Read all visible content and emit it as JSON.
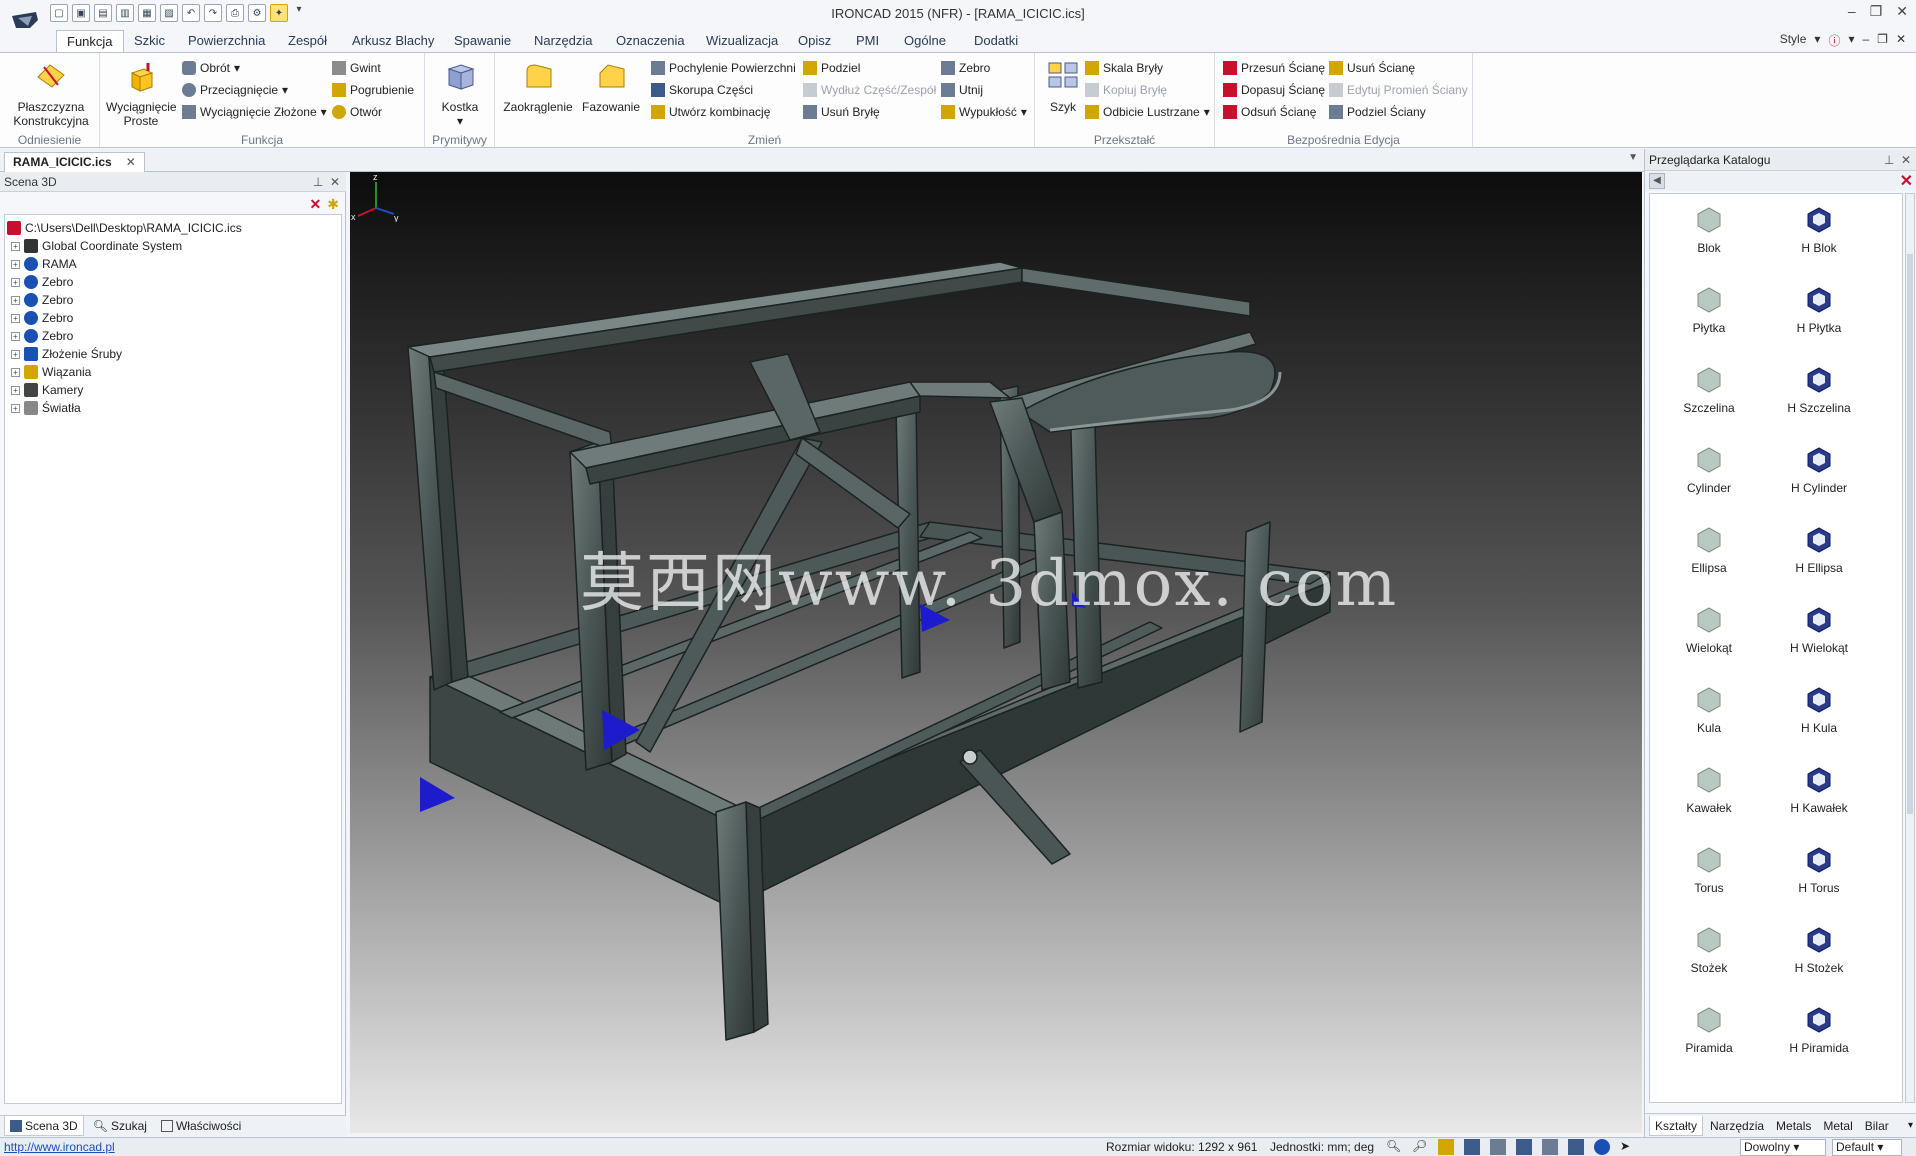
{
  "window": {
    "title": "IRONCAD 2015 (NFR) - [RAMA_ICICIC.ics]",
    "controls": [
      "–",
      "❐",
      "✕"
    ]
  },
  "quick_access": {
    "customize_glyph": "▾"
  },
  "ribbon": {
    "tabs": [
      "Funkcja",
      "Szkic",
      "Powierzchnia",
      "Zespół",
      "Arkusz Blachy",
      "Spawanie",
      "Narzędzia",
      "Oznaczenia",
      "Wizualizacja",
      "Opisz",
      "PMI",
      "Ogólne",
      "Dodatki"
    ],
    "active_tab": "Funkcja",
    "style_label": "Style",
    "groups": {
      "odniesienie": {
        "label": "Odniesienie",
        "plane_label_1": "Płaszczyzna",
        "plane_label_2": "Konstrukcyjna"
      },
      "funkcja": {
        "label": "Funkcja",
        "extrude_1": "Wyciągnięcie",
        "extrude_2": "Proste",
        "rotate": "Obrót",
        "sweep": "Przeciągnięcie",
        "loft": "Wyciągnięcie Złożone",
        "thread": "Gwint",
        "thicken": "Pogrubienie",
        "hole": "Otwór"
      },
      "prymitywy": {
        "label": "Prymitywy",
        "cube": "Kostka"
      },
      "zmien": {
        "label": "Zmień",
        "fillet": "Zaokrąglenie",
        "chamfer": "Fazowanie",
        "draft": "Pochylenie Powierzchni",
        "shell": "Skorupa Części",
        "combine": "Utwórz kombinację",
        "split": "Podziel",
        "extend": "Wydłuż Część/Zespół",
        "remove_body": "Usuń Bryłę",
        "rib": "Zebro",
        "trim": "Utnij",
        "emboss": "Wypukłość"
      },
      "przeksztalc": {
        "label": "Przekształć",
        "pattern": "Szyk",
        "scale": "Skala Bryły",
        "copy_body": "Kopiuj Bryłę",
        "mirror": "Odbicie Lustrzane"
      },
      "bezposrednia": {
        "label": "Bezpośrednia Edycja",
        "move_face": "Przesuń Ścianę",
        "match_face": "Dopasuj Ścianę",
        "offset_face": "Odsuń Ścianę",
        "delete_face": "Usuń Ścianę",
        "edit_radius": "Edytuj Promień Ściany",
        "split_face": "Podziel Ściany"
      }
    }
  },
  "document_tab": {
    "name": "RAMA_ICICIC.ics",
    "close": "✕"
  },
  "scene_panel": {
    "title": "Scena 3D",
    "pin": "📌",
    "close": "✕",
    "tree": [
      {
        "label": "C:\\Users\\Dell\\Desktop\\RAMA_ICICIC.ics",
        "icon": "scene-icon",
        "expander": false
      },
      {
        "label": "Global Coordinate System",
        "icon": "coordinate-system-icon",
        "expander": true
      },
      {
        "label": "RAMA",
        "icon": "part-icon",
        "expander": true
      },
      {
        "label": "Zebro",
        "icon": "part-icon",
        "expander": true
      },
      {
        "label": "Zebro",
        "icon": "part-icon",
        "expander": true
      },
      {
        "label": "Zebro",
        "icon": "part-icon",
        "expander": true
      },
      {
        "label": "Zebro",
        "icon": "part-icon",
        "expander": true
      },
      {
        "label": "Złożenie Śruby",
        "icon": "assembly-icon",
        "expander": true
      },
      {
        "label": "Wiązania",
        "icon": "constraints-icon",
        "expander": true
      },
      {
        "label": "Kamery",
        "icon": "camera-icon",
        "expander": true
      },
      {
        "label": "Światła",
        "icon": "light-icon",
        "expander": true
      }
    ],
    "bottom_tabs": [
      "Scena 3D",
      "Szukaj",
      "Właściwości"
    ]
  },
  "viewport": {
    "watermark": "莫西网www. 3dmox. com",
    "axis": {
      "x": "x",
      "y": "y",
      "z": "z"
    }
  },
  "catalog_panel": {
    "title": "Przeglądarka Katalogu",
    "items": [
      {
        "label": "Blok",
        "icon": "block-icon"
      },
      {
        "label": "H Blok",
        "icon": "hollow-block-icon"
      },
      {
        "label": "Płytka",
        "icon": "plate-icon"
      },
      {
        "label": "H Płytka",
        "icon": "hollow-plate-icon"
      },
      {
        "label": "Szczelina",
        "icon": "slot-icon"
      },
      {
        "label": "H Szczelina",
        "icon": "hollow-slot-icon"
      },
      {
        "label": "Cylinder",
        "icon": "cylinder-icon"
      },
      {
        "label": "H Cylinder",
        "icon": "hollow-cylinder-icon"
      },
      {
        "label": "Ellipsa",
        "icon": "ellipse-icon"
      },
      {
        "label": "H Ellipsa",
        "icon": "hollow-ellipse-icon"
      },
      {
        "label": "Wielokąt",
        "icon": "polygon-icon"
      },
      {
        "label": "H Wielokąt",
        "icon": "hollow-polygon-icon"
      },
      {
        "label": "Kula",
        "icon": "sphere-icon"
      },
      {
        "label": "H Kula",
        "icon": "hollow-sphere-icon"
      },
      {
        "label": "Kawałek",
        "icon": "wedge-icon"
      },
      {
        "label": "H Kawałek",
        "icon": "hollow-wedge-icon"
      },
      {
        "label": "Torus",
        "icon": "torus-icon"
      },
      {
        "label": "H Torus",
        "icon": "hollow-torus-icon"
      },
      {
        "label": "Stożek",
        "icon": "cone-icon"
      },
      {
        "label": "H Stożek",
        "icon": "hollow-cone-icon"
      },
      {
        "label": "Piramida",
        "icon": "pyramid-icon"
      },
      {
        "label": "H Piramida",
        "icon": "hollow-pyramid-icon"
      }
    ],
    "tabs": [
      "Kształty",
      "Narzędzia",
      "Metals",
      "Metal",
      "Bilar"
    ]
  },
  "status": {
    "link": "http://www.ironcad.pl",
    "view_size": "Rozmiar widoku: 1292 x 961",
    "units": "Jednostki: mm; deg",
    "select_filter": "Dowolny",
    "style_select": "Default"
  },
  "colors": {
    "accent": "#ffd24a",
    "frame": "#4f5b5a",
    "gusset": "#1c1ccc",
    "viewport_top": "#0c0c0c",
    "viewport_bottom": "#e8e8e8"
  }
}
